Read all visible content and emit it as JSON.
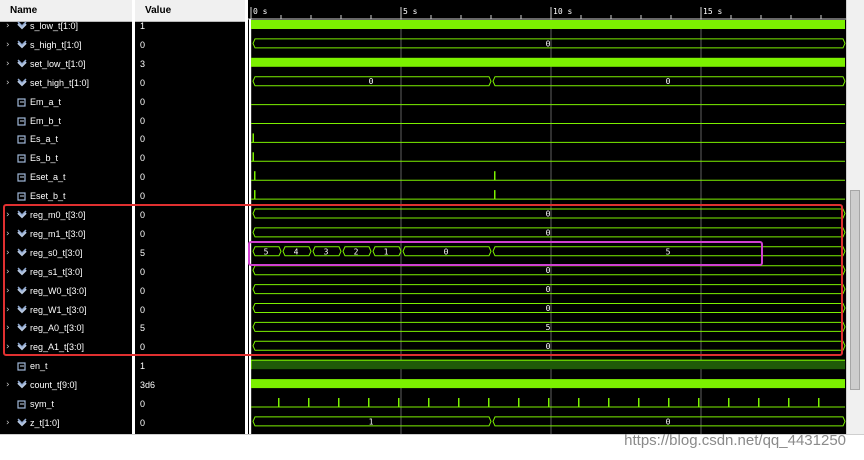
{
  "header": {
    "name_label": "Name",
    "value_label": "Value"
  },
  "colors": {
    "wave": "#7cf000",
    "marker_line": "#606060",
    "red_box": "#e03030",
    "magenta_box": "#d040d0",
    "cursor": "#ffffff"
  },
  "timeline": {
    "ticks": [
      {
        "label": "0 s",
        "t": 0
      },
      {
        "label": "5 s",
        "t": 5
      },
      {
        "label": "10 s",
        "t": 10
      },
      {
        "label": "15 s",
        "t": 15
      }
    ],
    "end": 19.8
  },
  "signals": [
    {
      "name": "s_low_t[1:0]",
      "value": "1",
      "type": "bus",
      "wave": "dense"
    },
    {
      "name": "s_high_t[1:0]",
      "value": "0",
      "type": "bus",
      "wave": "bus",
      "segs": [
        {
          "t0": 0,
          "t1": 19.8,
          "label": "0"
        }
      ]
    },
    {
      "name": "set_low_t[1:0]",
      "value": "3",
      "type": "bus",
      "wave": "dense"
    },
    {
      "name": "set_high_t[1:0]",
      "value": "0",
      "type": "bus",
      "wave": "bus",
      "segs": [
        {
          "t0": 0,
          "t1": 8,
          "label": "0"
        },
        {
          "t0": 8,
          "t1": 19.8,
          "label": "0"
        }
      ]
    },
    {
      "name": "Em_a_t",
      "value": "0",
      "type": "bit",
      "wave": "low"
    },
    {
      "name": "Em_b_t",
      "value": "0",
      "type": "bit",
      "wave": "low"
    },
    {
      "name": "Es_a_t",
      "value": "0",
      "type": "bit",
      "wave": "pulses",
      "pulses": [
        0.05
      ]
    },
    {
      "name": "Es_b_t",
      "value": "0",
      "type": "bit",
      "wave": "pulses",
      "pulses": [
        0.05
      ]
    },
    {
      "name": "Eset_a_t",
      "value": "0",
      "type": "bit",
      "wave": "pulses",
      "pulses": [
        0.1,
        8.1
      ]
    },
    {
      "name": "Eset_b_t",
      "value": "0",
      "type": "bit",
      "wave": "pulses",
      "pulses": [
        0.1,
        8.1
      ]
    },
    {
      "name": "reg_m0_t[3:0]",
      "value": "0",
      "type": "bus",
      "wave": "bus",
      "segs": [
        {
          "t0": 0,
          "t1": 19.8,
          "label": "0"
        }
      ]
    },
    {
      "name": "reg_m1_t[3:0]",
      "value": "0",
      "type": "bus",
      "wave": "bus",
      "segs": [
        {
          "t0": 0,
          "t1": 19.8,
          "label": "0"
        }
      ]
    },
    {
      "name": "reg_s0_t[3:0]",
      "value": "5",
      "type": "bus",
      "wave": "bus",
      "segs": [
        {
          "t0": 0,
          "t1": 1,
          "label": "5"
        },
        {
          "t0": 1,
          "t1": 2,
          "label": "4"
        },
        {
          "t0": 2,
          "t1": 3,
          "label": "3"
        },
        {
          "t0": 3,
          "t1": 4,
          "label": "2"
        },
        {
          "t0": 4,
          "t1": 5,
          "label": "1"
        },
        {
          "t0": 5,
          "t1": 8,
          "label": "0"
        },
        {
          "t0": 8,
          "t1": 19.8,
          "label": "5"
        }
      ]
    },
    {
      "name": "reg_s1_t[3:0]",
      "value": "0",
      "type": "bus",
      "wave": "bus",
      "segs": [
        {
          "t0": 0,
          "t1": 19.8,
          "label": "0"
        }
      ]
    },
    {
      "name": "reg_W0_t[3:0]",
      "value": "0",
      "type": "bus",
      "wave": "bus",
      "segs": [
        {
          "t0": 0,
          "t1": 19.8,
          "label": "0"
        }
      ]
    },
    {
      "name": "reg_W1_t[3:0]",
      "value": "0",
      "type": "bus",
      "wave": "bus",
      "segs": [
        {
          "t0": 0,
          "t1": 19.8,
          "label": "0"
        }
      ]
    },
    {
      "name": "reg_A0_t[3:0]",
      "value": "5",
      "type": "bus",
      "wave": "bus",
      "segs": [
        {
          "t0": 0,
          "t1": 19.8,
          "label": "5"
        }
      ]
    },
    {
      "name": "reg_A1_t[3:0]",
      "value": "0",
      "type": "bus",
      "wave": "bus",
      "segs": [
        {
          "t0": 0,
          "t1": 19.8,
          "label": "0"
        }
      ]
    },
    {
      "name": "en_t",
      "value": "1",
      "type": "bit",
      "wave": "high"
    },
    {
      "name": "count_t[9:0]",
      "value": "3d6",
      "type": "bus",
      "wave": "dense"
    },
    {
      "name": "sym_t",
      "value": "0",
      "type": "bit",
      "wave": "pulses",
      "pulses": [
        0.9,
        1.9,
        2.9,
        3.9,
        4.9,
        5.9,
        6.9,
        7.9,
        8.9,
        9.9,
        10.9,
        11.9,
        12.9,
        13.9,
        14.9,
        15.9,
        16.9,
        17.9,
        18.9
      ]
    },
    {
      "name": "z_t[1:0]",
      "value": "0",
      "type": "bus",
      "wave": "bus",
      "segs": [
        {
          "t0": 0,
          "t1": 8,
          "label": "1"
        },
        {
          "t0": 8,
          "t1": 19.8,
          "label": "0"
        }
      ]
    }
  ],
  "watermark": "https://blog.csdn.net/qq_4431250"
}
